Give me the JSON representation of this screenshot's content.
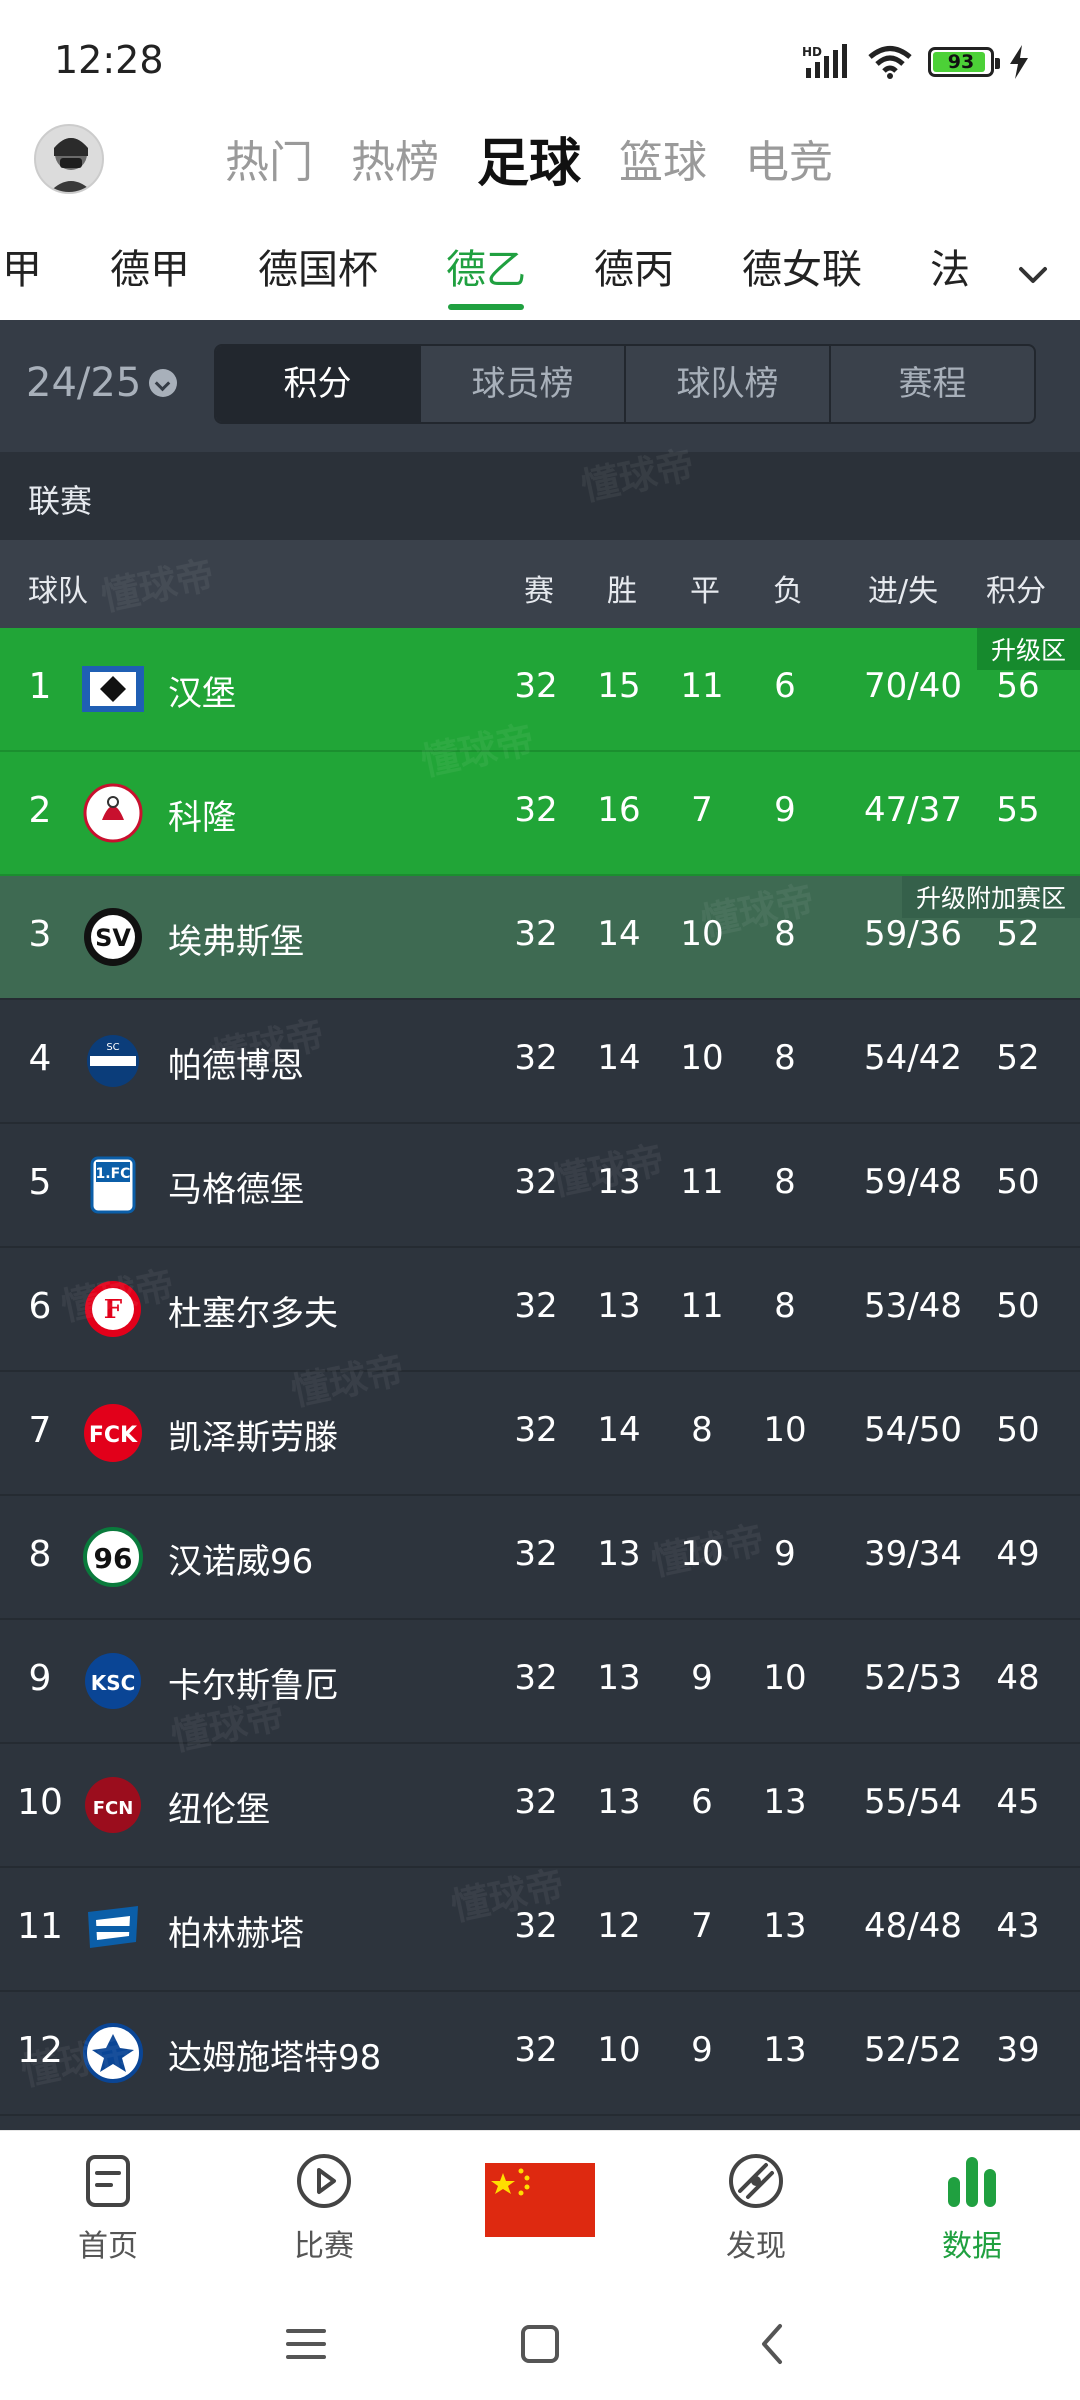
{
  "status_bar": {
    "time": "12:28",
    "battery": "93",
    "network": "HD"
  },
  "top_tabs": [
    "热门",
    "热榜",
    "足球",
    "篮球",
    "电竞"
  ],
  "top_active": 2,
  "league_tabs": [
    "甲",
    "德甲",
    "德国杯",
    "德乙",
    "德丙",
    "德女联",
    "法"
  ],
  "league_active": 3,
  "season": "24/25",
  "segments": [
    "积分",
    "球员榜",
    "球队榜",
    "赛程"
  ],
  "segment_active": 0,
  "league_header": "联赛",
  "columns": {
    "team": "球队",
    "played": "赛",
    "win": "胜",
    "draw": "平",
    "loss": "负",
    "goals": "进/失",
    "points": "积分"
  },
  "zones": {
    "promotion": "升级区",
    "playoff": "升级附加赛区"
  },
  "watermark": "懂球帝",
  "rows": [
    {
      "pos": "1",
      "team": "汉堡",
      "played": "32",
      "w": "15",
      "d": "11",
      "l": "6",
      "goals": "70/40",
      "pts": "56"
    },
    {
      "pos": "2",
      "team": "科隆",
      "played": "32",
      "w": "16",
      "d": "7",
      "l": "9",
      "goals": "47/37",
      "pts": "55"
    },
    {
      "pos": "3",
      "team": "埃弗斯堡",
      "played": "32",
      "w": "14",
      "d": "10",
      "l": "8",
      "goals": "59/36",
      "pts": "52"
    },
    {
      "pos": "4",
      "team": "帕德博恩",
      "played": "32",
      "w": "14",
      "d": "10",
      "l": "8",
      "goals": "54/42",
      "pts": "52"
    },
    {
      "pos": "5",
      "team": "马格德堡",
      "played": "32",
      "w": "13",
      "d": "11",
      "l": "8",
      "goals": "59/48",
      "pts": "50"
    },
    {
      "pos": "6",
      "team": "杜塞尔多夫",
      "played": "32",
      "w": "13",
      "d": "11",
      "l": "8",
      "goals": "53/48",
      "pts": "50"
    },
    {
      "pos": "7",
      "team": "凯泽斯劳滕",
      "played": "32",
      "w": "14",
      "d": "8",
      "l": "10",
      "goals": "54/50",
      "pts": "50"
    },
    {
      "pos": "8",
      "team": "汉诺威96",
      "played": "32",
      "w": "13",
      "d": "10",
      "l": "9",
      "goals": "39/34",
      "pts": "49"
    },
    {
      "pos": "9",
      "team": "卡尔斯鲁厄",
      "played": "32",
      "w": "13",
      "d": "9",
      "l": "10",
      "goals": "52/53",
      "pts": "48"
    },
    {
      "pos": "10",
      "team": "纽伦堡",
      "played": "32",
      "w": "13",
      "d": "6",
      "l": "13",
      "goals": "55/54",
      "pts": "45"
    },
    {
      "pos": "11",
      "team": "柏林赫塔",
      "played": "32",
      "w": "12",
      "d": "7",
      "l": "13",
      "goals": "48/48",
      "pts": "43"
    },
    {
      "pos": "12",
      "team": "达姆施塔特98",
      "played": "32",
      "w": "10",
      "d": "9",
      "l": "13",
      "goals": "52/52",
      "pts": "39"
    }
  ],
  "bottom_nav": [
    "首页",
    "比赛",
    "",
    "发现",
    "数据"
  ],
  "bottom_active": 4,
  "colors": {
    "accent": "#20a040",
    "promotion": "#21a537",
    "playoff": "#3e6a52",
    "panel": "#2d343d"
  }
}
